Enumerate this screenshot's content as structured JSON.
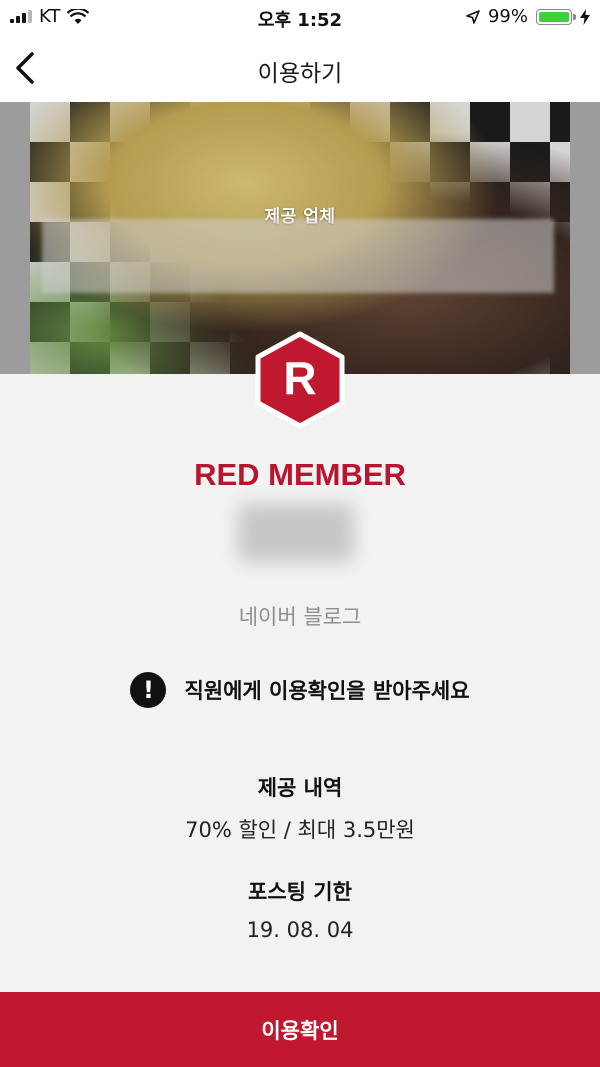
{
  "status_bar": {
    "carrier": "KT",
    "time": "오후 1:52",
    "battery_percent": "99%",
    "battery_level": 0.99,
    "icons": [
      "signal-bars-icon",
      "wifi-icon",
      "location-arrow-icon",
      "battery-icon",
      "charging-bolt-icon"
    ]
  },
  "navbar": {
    "title": "이용하기",
    "back_icon": "chevron-left-icon"
  },
  "hero": {
    "label": "제공 업체"
  },
  "badge": {
    "letter": "R",
    "color": "#c0182f"
  },
  "member": {
    "tier": "RED MEMBER",
    "platform": "네이버 블로그"
  },
  "notice": {
    "icon": "exclamation-circle-icon",
    "text": "직원에게 이용확인을 받아주세요"
  },
  "offer": {
    "title": "제공 내역",
    "value": "70% 할인 / 최대 3.5만원"
  },
  "posting": {
    "title": "포스팅 기한",
    "value": "19. 08. 04"
  },
  "confirm_button": {
    "label": "이용확인",
    "color": "#c0182f"
  }
}
